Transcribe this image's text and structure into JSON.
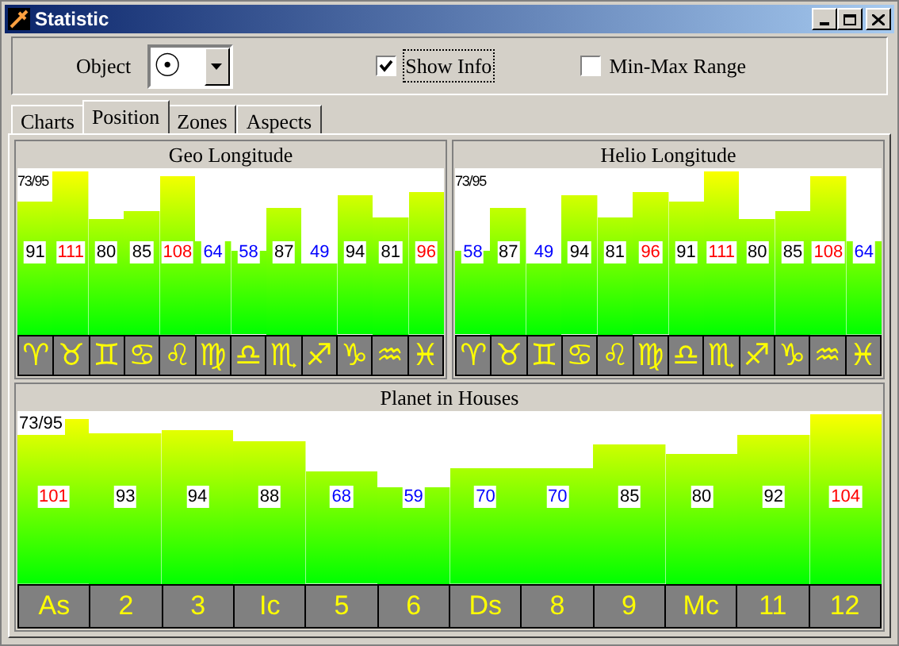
{
  "window": {
    "title": "Statistic"
  },
  "toolbar": {
    "object_label": "Object",
    "object_value": "☉",
    "show_info": {
      "label": "Show Info",
      "checked": true
    },
    "min_max": {
      "label": "Min-Max Range",
      "checked": false
    }
  },
  "tabs": [
    {
      "label": "Charts",
      "selected": false
    },
    {
      "label": "Position",
      "selected": true
    },
    {
      "label": "Zones",
      "selected": false
    },
    {
      "label": "Aspects",
      "selected": false
    }
  ],
  "panels": [
    {
      "title": "Geo Longitude",
      "info": "73/95",
      "bars": [
        {
          "value": "91",
          "color": "#000000",
          "level": 0.82,
          "sign": "♈"
        },
        {
          "value": "111",
          "color": "#ff0000",
          "level": 1.0,
          "sign": "♉"
        },
        {
          "value": "80",
          "color": "#000000",
          "level": 0.71,
          "sign": "♊"
        },
        {
          "value": "85",
          "color": "#000000",
          "level": 0.76,
          "sign": "♋"
        },
        {
          "value": "108",
          "color": "#ff0000",
          "level": 0.97,
          "sign": "♌"
        },
        {
          "value": "64",
          "color": "#0000ff",
          "level": 0.57,
          "sign": "♍"
        },
        {
          "value": "58",
          "color": "#0000ff",
          "level": 0.51,
          "sign": "♎"
        },
        {
          "value": "87",
          "color": "#000000",
          "level": 0.78,
          "sign": "♏"
        },
        {
          "value": "49",
          "color": "#0000ff",
          "level": 0.44,
          "sign": "♐"
        },
        {
          "value": "94",
          "color": "#000000",
          "level": 0.85,
          "sign": "♑"
        },
        {
          "value": "81",
          "color": "#000000",
          "level": 0.72,
          "sign": "♒"
        },
        {
          "value": "96",
          "color": "#ff0000",
          "level": 0.87,
          "sign": "♓"
        }
      ]
    },
    {
      "title": "Helio Longitude",
      "info": "73/95",
      "bars": [
        {
          "value": "58",
          "color": "#0000ff",
          "level": 0.51,
          "sign": "♈"
        },
        {
          "value": "87",
          "color": "#000000",
          "level": 0.78,
          "sign": "♉"
        },
        {
          "value": "49",
          "color": "#0000ff",
          "level": 0.44,
          "sign": "♊"
        },
        {
          "value": "94",
          "color": "#000000",
          "level": 0.85,
          "sign": "♋"
        },
        {
          "value": "81",
          "color": "#000000",
          "level": 0.72,
          "sign": "♌"
        },
        {
          "value": "96",
          "color": "#ff0000",
          "level": 0.87,
          "sign": "♍"
        },
        {
          "value": "91",
          "color": "#000000",
          "level": 0.82,
          "sign": "♎"
        },
        {
          "value": "111",
          "color": "#ff0000",
          "level": 1.0,
          "sign": "♏"
        },
        {
          "value": "80",
          "color": "#000000",
          "level": 0.71,
          "sign": "♐"
        },
        {
          "value": "85",
          "color": "#000000",
          "level": 0.76,
          "sign": "♑"
        },
        {
          "value": "108",
          "color": "#ff0000",
          "level": 0.97,
          "sign": "♒"
        },
        {
          "value": "64",
          "color": "#0000ff",
          "level": 0.57,
          "sign": "♓"
        }
      ]
    },
    {
      "title": "Planet in Houses",
      "info": "73/95",
      "bars": [
        {
          "value": "101",
          "color": "#ff0000",
          "level": 0.97,
          "sign": "As"
        },
        {
          "value": "93",
          "color": "#000000",
          "level": 0.89,
          "sign": "2"
        },
        {
          "value": "94",
          "color": "#000000",
          "level": 0.91,
          "sign": "3"
        },
        {
          "value": "88",
          "color": "#000000",
          "level": 0.84,
          "sign": "Ic"
        },
        {
          "value": "68",
          "color": "#0000ff",
          "level": 0.66,
          "sign": "5"
        },
        {
          "value": "59",
          "color": "#0000ff",
          "level": 0.57,
          "sign": "6"
        },
        {
          "value": "70",
          "color": "#0000ff",
          "level": 0.68,
          "sign": "Ds"
        },
        {
          "value": "70",
          "color": "#0000ff",
          "level": 0.68,
          "sign": "8"
        },
        {
          "value": "85",
          "color": "#000000",
          "level": 0.82,
          "sign": "9"
        },
        {
          "value": "80",
          "color": "#000000",
          "level": 0.77,
          "sign": "Mc"
        },
        {
          "value": "92",
          "color": "#000000",
          "level": 0.88,
          "sign": "11"
        },
        {
          "value": "104",
          "color": "#ff0000",
          "level": 1.0,
          "sign": "12"
        }
      ]
    }
  ]
}
